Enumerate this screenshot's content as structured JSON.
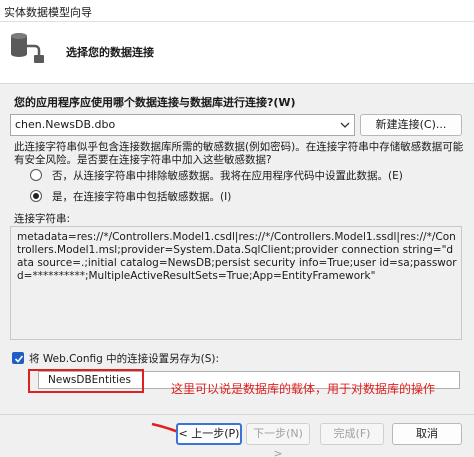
{
  "window": {
    "title": "实体数据模型向导"
  },
  "header": {
    "subtitle": "选择您的数据连接"
  },
  "question": "您的应用程序应使用哪个数据连接与数据库进行连接?(W)",
  "connection": {
    "selected": "chen.NewsDB.dbo",
    "new_button": "新建连接(C)..."
  },
  "sensitive_note": "此连接字符串似乎包含连接数据库所需的敏感数据(例如密码)。在连接字符串中存储敏感数据可能有安全风险。是否要在连接字符串中加入这些敏感数据?",
  "options": [
    {
      "label": "否，从连接字符串中排除敏感数据。我将在应用程序代码中设置此数据。(E)",
      "checked": false
    },
    {
      "label": "是，在连接字符串中包括敏感数据。(I)",
      "checked": true
    }
  ],
  "conn_string_label": "连接字符串:",
  "conn_string": "metadata=res://*/Controllers.Model1.csdl|res://*/Controllers.Model1.ssdl|res://*/Controllers.Model1.msl;provider=System.Data.SqlClient;provider connection string=\"data source=.;initial catalog=NewsDB;persist security info=True;user id=sa;password=**********;MultipleActiveResultSets=True;App=EntityFramework\"",
  "save": {
    "label": "将 Web.Config 中的连接设置另存为(S):",
    "checked": true,
    "value": "NewsDBEntities"
  },
  "annotation": "这里可以说是数据库的载体，用于对数据库的操作",
  "buttons": {
    "prev": "< 上一步(P)",
    "next": "下一步(N) >",
    "finish": "完成(F)",
    "cancel": "取消"
  },
  "colors": {
    "accent": "#3b73d6",
    "checkbox": "#1d5fc7",
    "annotation": "#e02020"
  }
}
